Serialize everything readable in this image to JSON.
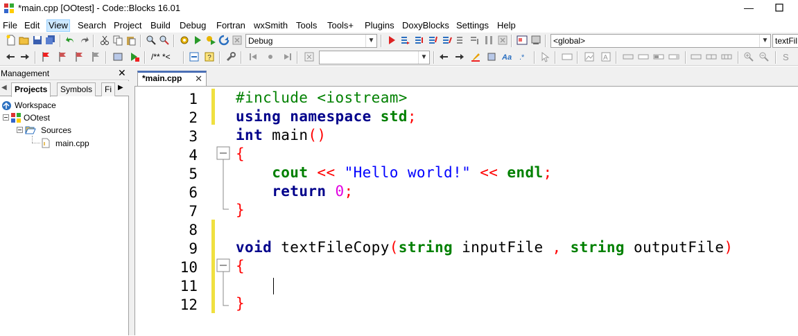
{
  "titlebar": {
    "title": "*main.cpp [OOtest] - Code::Blocks 16.01",
    "minimize": "—"
  },
  "menu": [
    "File",
    "Edit",
    "View",
    "Search",
    "Project",
    "Build",
    "Debug",
    "Fortran",
    "wxSmith",
    "Tools",
    "Tools+",
    "Plugins",
    "DoxyBlocks",
    "Settings",
    "Help"
  ],
  "toolbar": {
    "build_target": "Debug",
    "scope": "<global>",
    "function": "textFil",
    "comment_label": "/** *<",
    "search_value": ""
  },
  "management": {
    "title": "Management",
    "close": "✕",
    "tabs": [
      "Projects",
      "Symbols",
      "Fi"
    ],
    "tree": [
      {
        "label": "Workspace"
      },
      {
        "label": "OOtest"
      },
      {
        "label": "Sources"
      },
      {
        "label": "main.cpp"
      }
    ]
  },
  "editor": {
    "tab_label": "*main.cpp",
    "tab_close": "✕",
    "line_numbers": [
      "1",
      "2",
      "3",
      "4",
      "5",
      "6",
      "7",
      "8",
      "9",
      "10",
      "11",
      "12"
    ],
    "code": {
      "l1_include": "#include <iostream>",
      "l2_using": "using",
      "l2_namespace": "namespace",
      "l2_std": "std",
      "l2_semi": ";",
      "l3_int": "int",
      "l3_main": " main",
      "l3_parens": "()",
      "l4_brace": "{",
      "l5_cout": "cout",
      "l5_op1": " << ",
      "l5_str": "\"Hello world!\"",
      "l5_op2": " << ",
      "l5_endl": "endl",
      "l5_semi": ";",
      "l6_return": "return",
      "l6_zero": "0",
      "l6_semi": ";",
      "l7_brace": "}",
      "l9_void": "void",
      "l9_name": " textFileCopy",
      "l9_lp": "(",
      "l9_string1": "string",
      "l9_param1": " inputFile ",
      "l9_comma": ",",
      "l9_string2": "string",
      "l9_param2": " outputFile",
      "l9_rp": ")",
      "l10_brace": "{",
      "l12_brace": "}"
    }
  },
  "colors": {
    "change_marker": "#f0e040",
    "active_tab": "#4a6fb5",
    "menu_highlight": "#cce8ff"
  }
}
